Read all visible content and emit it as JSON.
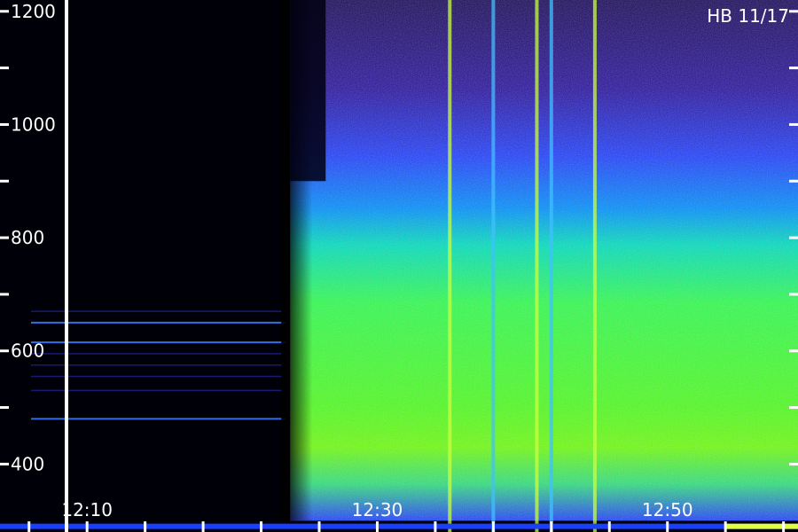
{
  "chart_data": {
    "type": "heatmap",
    "title": "",
    "xlabel": "",
    "ylabel": "",
    "annotation": "HB 11/17",
    "y_axis": {
      "range": [
        280,
        1220
      ],
      "major_ticks": [
        400,
        600,
        800,
        1000,
        1200
      ],
      "major_tick_labels": [
        "400",
        "600",
        "800",
        "1000",
        "1200"
      ],
      "minor_ticks": [
        500,
        700,
        900,
        1100
      ]
    },
    "x_axis": {
      "range_start": "12:04",
      "range_end": "12:59",
      "labeled_ticks": [
        "12:10",
        "12:30",
        "12:50"
      ],
      "minor_ticks": [
        "12:06",
        "12:14",
        "12:18",
        "12:22",
        "12:26",
        "12:34",
        "12:38",
        "12:42",
        "12:46",
        "12:54",
        "12:58"
      ]
    },
    "emission": {
      "quiet_period": [
        "12:04",
        "12:24"
      ],
      "onset_time": "12:24",
      "active_period": [
        "12:24",
        "12:59"
      ],
      "peak_band_range": [
        420,
        700
      ],
      "moderate_band_range": [
        700,
        900
      ],
      "weak_band_range": [
        900,
        1100
      ],
      "pre_onset_lines": [
        480,
        530,
        555,
        575,
        595,
        615,
        650,
        670
      ],
      "interference_strip_times": [
        "12:35",
        "12:38",
        "12:41",
        "12:42",
        "12:45"
      ]
    },
    "colorscale": [
      "#000010",
      "#1a0a6a",
      "#2020ff",
      "#00a0ff",
      "#00ffa0",
      "#40ff20",
      "#ffff40"
    ],
    "grid": false,
    "legend": "none"
  }
}
